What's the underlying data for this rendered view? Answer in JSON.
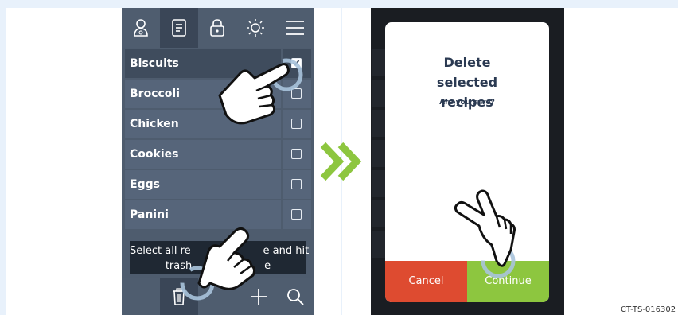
{
  "left_screen": {
    "toolbar_icons": [
      "person-icon",
      "recipe-icon",
      "lock-icon",
      "brightness-icon",
      "menu-icon"
    ],
    "recipes": [
      {
        "name": "Biscuits",
        "checked": true
      },
      {
        "name": "Broccoli",
        "checked": false
      },
      {
        "name": "Chicken",
        "checked": false
      },
      {
        "name": "Cookies",
        "checked": false
      },
      {
        "name": "Eggs",
        "checked": false
      },
      {
        "name": "Panini",
        "checked": false
      }
    ],
    "tooltip_line1": "Select all re                      e and hit",
    "tooltip_line2": "trash                      e",
    "bottom_icons": [
      "trash-icon",
      "plus-icon",
      "search-icon"
    ]
  },
  "right_screen": {
    "dialog_title": "Delete selected recipes",
    "dialog_subtitle": "Are you sure?",
    "cancel_label": "Cancel",
    "continue_label": "Continue"
  },
  "reference_code": "CT-TS-016302",
  "colors": {
    "background": "#e8f1fb",
    "arrow": "#8dc63f",
    "cancel": "#de4b30",
    "continue": "#8dc63f",
    "list_row": "#56657a"
  }
}
